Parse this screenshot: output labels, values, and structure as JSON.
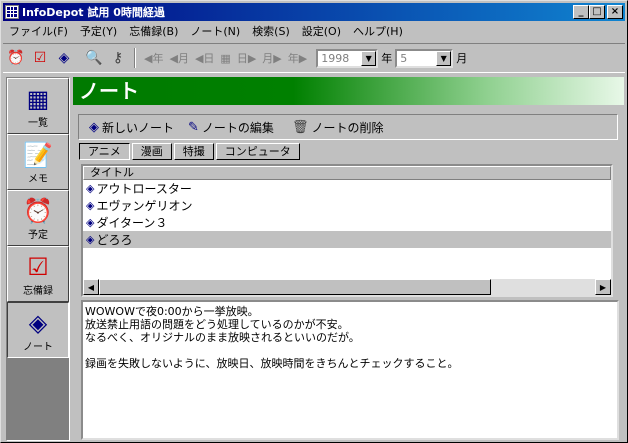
{
  "window": {
    "title": "InfoDepot 試用 0時間経過"
  },
  "menu": [
    "ファイル(F)",
    "予定(Y)",
    "忘備録(B)",
    "ノート(N)",
    "検索(S)",
    "設定(O)",
    "ヘルプ(H)"
  ],
  "toolbar": {
    "nav": [
      "年",
      "月",
      "日",
      "日",
      "月",
      "年"
    ],
    "year_value": "1998",
    "year_label": "年",
    "month_value": "5",
    "month_label": "月"
  },
  "sidebar": {
    "items": [
      {
        "label": "一覧",
        "icon": "calendar-grid-icon"
      },
      {
        "label": "メモ",
        "icon": "notepad-icon"
      },
      {
        "label": "予定",
        "icon": "alarm-clock-icon"
      },
      {
        "label": "忘備録",
        "icon": "checkbox-icon"
      },
      {
        "label": "ノート",
        "icon": "book-icon"
      }
    ]
  },
  "header": {
    "title": "ノート"
  },
  "actions": {
    "new": "新しいノート",
    "edit": "ノートの編集",
    "delete": "ノートの削除"
  },
  "tabs": [
    "アニメ",
    "漫画",
    "特撮",
    "コンピュータ"
  ],
  "list": {
    "column": "タイトル",
    "rows": [
      "アウトロースター",
      "エヴァンゲリオン",
      "ダイターン３",
      "どろろ"
    ]
  },
  "memo": {
    "lines": [
      "WOWOWで夜0:00から一挙放映。",
      "放送禁止用語の問題をどう処理しているのかが不安。",
      "なるべく、オリジナルのまま放映されるといいのだが。",
      "",
      "録画を失敗しないように、放映日、放映時間をきちんとチェックすること。"
    ]
  }
}
